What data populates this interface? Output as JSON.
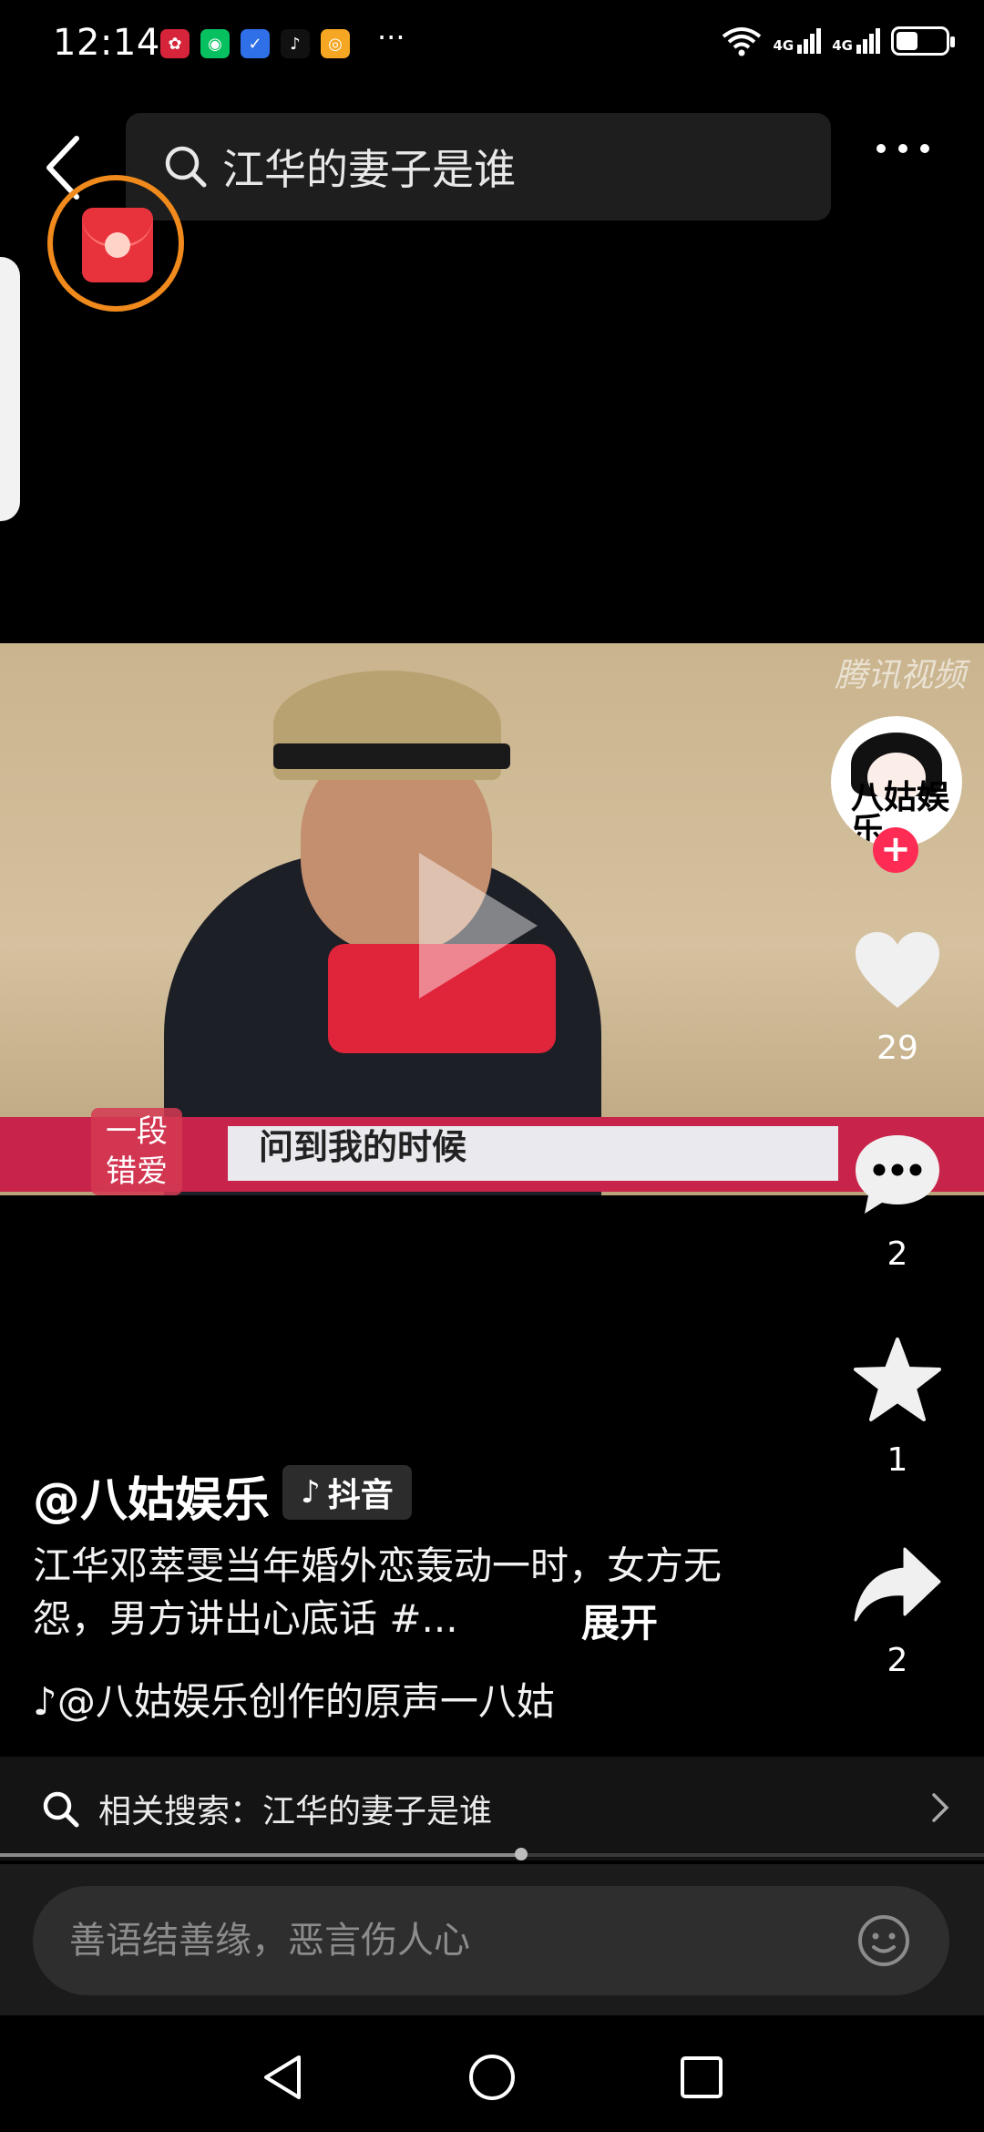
{
  "status_bar": {
    "time": "12:14",
    "more": "···",
    "network_1": "4G",
    "network_2": "4G",
    "battery_percent": 45
  },
  "top_bar": {
    "search_text": "江华的妻子是谁"
  },
  "video": {
    "watermark": "腾讯视频",
    "badge_line1": "一段",
    "badge_line2": "错爱",
    "subtitle": "问到我的时候",
    "progress_fraction": 0.53
  },
  "actions": {
    "avatar_text": "八姑娱乐",
    "follow_symbol": "+",
    "likes": "29",
    "comments": "2",
    "favorites": "1",
    "shares": "2"
  },
  "post": {
    "author": "@八姑娱乐",
    "platform": "抖音",
    "description": "江华邓萃雯当年婚外恋轰动一时，女方无怨，男方讲出心底话 #...",
    "expand": "展开",
    "music": "@八姑娱乐创作的原声一八姑"
  },
  "related": {
    "text": "相关搜索：江华的妻子是谁"
  },
  "comment": {
    "placeholder": "善语结善缘，恶言伤人心"
  },
  "colors": {
    "accent_red": "#fe2c55",
    "redpacket_ring": "#f08a1c",
    "background": "#000000"
  }
}
